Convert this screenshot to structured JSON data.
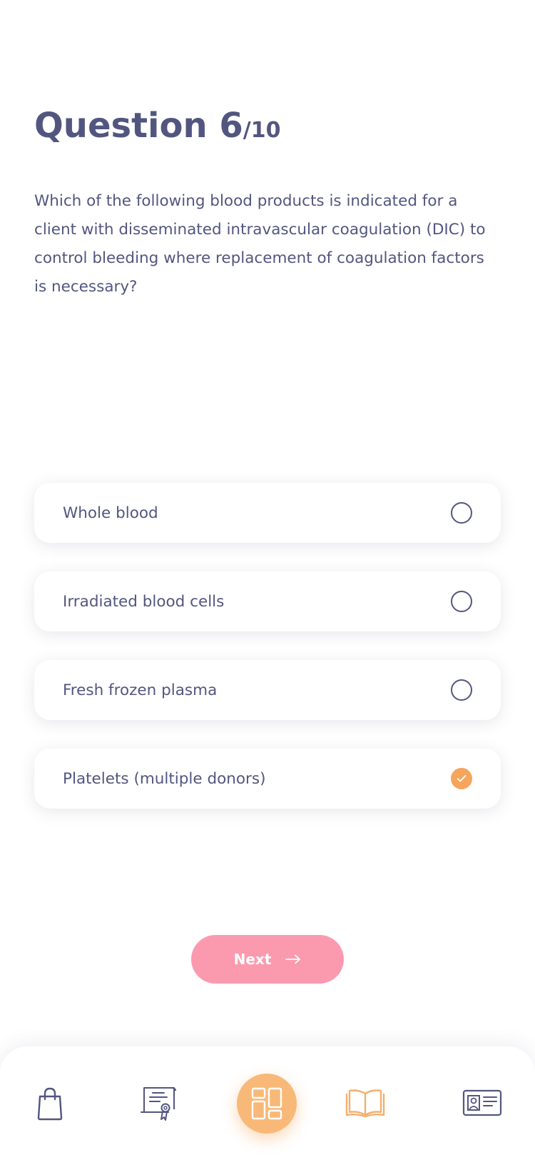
{
  "header": {
    "question_label": "Question 6",
    "question_total": "/10"
  },
  "question": {
    "text": "Which of the following blood products is indicated for a client with disseminated intravascular coagulation (DIC) to control bleeding where replacement of coagulation factors is necessary?"
  },
  "options": [
    {
      "label": "Whole blood",
      "selected": false
    },
    {
      "label": "Irradiated blood cells",
      "selected": false
    },
    {
      "label": "Fresh frozen plasma",
      "selected": false
    },
    {
      "label": "Platelets (multiple donors)",
      "selected": true
    }
  ],
  "next_button": {
    "label": "Next"
  },
  "tabbar": {
    "items": [
      {
        "icon": "shopping-bag-icon",
        "active": false
      },
      {
        "icon": "certificate-icon",
        "active": false
      },
      {
        "icon": "dashboard-icon",
        "active": true
      },
      {
        "icon": "book-icon",
        "active": false
      },
      {
        "icon": "id-card-icon",
        "active": false
      }
    ]
  },
  "colors": {
    "text": "#52567f",
    "accent_orange": "#f6a55c",
    "next_button": "#fb9aaf",
    "tab_active_bg": "#f8b978",
    "book_icon": "#f3b06e"
  }
}
